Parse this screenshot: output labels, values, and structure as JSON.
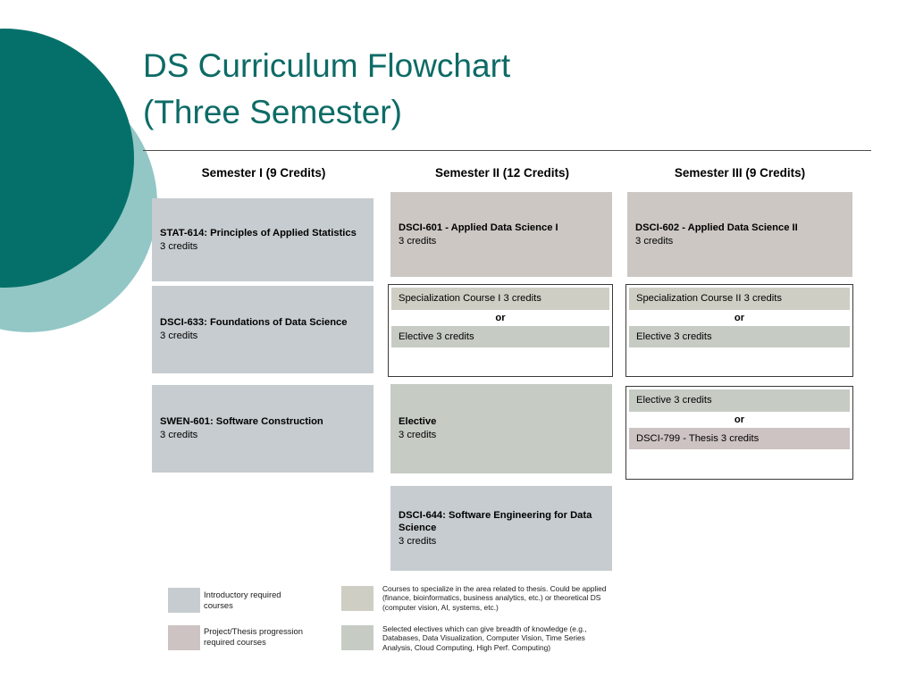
{
  "slide": {
    "title_line1": "DS Curriculum Flowchart",
    "title_line2": "(Three Semester)",
    "title_color": "#0d6b66"
  },
  "decoration": {
    "circle_dark_color": "#05706a",
    "circle_light_color": "#92c7c6"
  },
  "colors": {
    "intro_required": "#c6ccd0",
    "core_applied": "#ccc7c3",
    "specialization": "#cecec4",
    "elective": "#c6cbc4",
    "thesis": "#cdc3c2",
    "group_border": "#3a3a3a"
  },
  "columns": [
    {
      "id": "semester-1",
      "header": "Semester I (9 Credits)",
      "boxes": [
        {
          "title": "STAT-614: Principles of Applied Statistics",
          "credits": "3 credits",
          "type": "intro_required"
        },
        {
          "title": "DSCI-633: Foundations of Data Science",
          "credits": "3 credits",
          "type": "intro_required"
        },
        {
          "title": "SWEN-601: Software Construction",
          "credits": "3 credits",
          "type": "intro_required"
        }
      ]
    },
    {
      "id": "semester-2",
      "header": "Semester II (12 Credits)",
      "boxes": [
        {
          "title": "DSCI-601 - Applied Data Science I",
          "credits": "3 credits",
          "type": "core_applied"
        },
        {
          "title": "Elective",
          "credits": "3 credits",
          "type": "elective"
        },
        {
          "title": "DSCI-644: Software Engineering for Data Science",
          "credits": "3 credits",
          "type": "intro_required"
        }
      ],
      "group": {
        "option_a": {
          "title": "Specialization Course I",
          "credits": "3 credits",
          "type": "specialization"
        },
        "connector": "or",
        "option_b": {
          "title": "Elective",
          "credits": "3 credits",
          "type": "elective"
        }
      }
    },
    {
      "id": "semester-3",
      "header": "Semester III (9 Credits)",
      "boxes": [
        {
          "title": "DSCI-602 - Applied Data Science II",
          "credits": "3 credits",
          "type": "core_applied"
        }
      ],
      "group_1": {
        "option_a": {
          "title": "Specialization Course II",
          "credits": "3 credits",
          "type": "specialization"
        },
        "connector": "or",
        "option_b": {
          "title": "Elective",
          "credits": "3 credits",
          "type": "elective"
        }
      },
      "group_2": {
        "option_a": {
          "title": "Elective",
          "credits": "3 credits",
          "type": "elective"
        },
        "connector": "or",
        "option_b": {
          "title": "DSCI-799 - Thesis",
          "credits": "3 credits",
          "type": "thesis"
        }
      }
    }
  ],
  "legend": [
    {
      "id": "intro",
      "swatch": "#c6ccd0",
      "text": "Introductory required courses"
    },
    {
      "id": "thesis",
      "swatch": "#cdc3c2",
      "text": "Project/Thesis progression required courses"
    },
    {
      "id": "specialization",
      "swatch": "#cecec4",
      "text": "Courses to specialize in the area related to thesis. Could be applied (finance, bioinformatics, business analytics, etc.) or theoretical DS (computer vision, AI, systems, etc.)"
    },
    {
      "id": "electives",
      "swatch": "#c6cbc4",
      "text": "Selected electives which can give breadth of knowledge (e.g., Databases, Data Visualization, Computer Vision, Time Series Analysis, Cloud Computing, High Perf. Computing)"
    }
  ]
}
